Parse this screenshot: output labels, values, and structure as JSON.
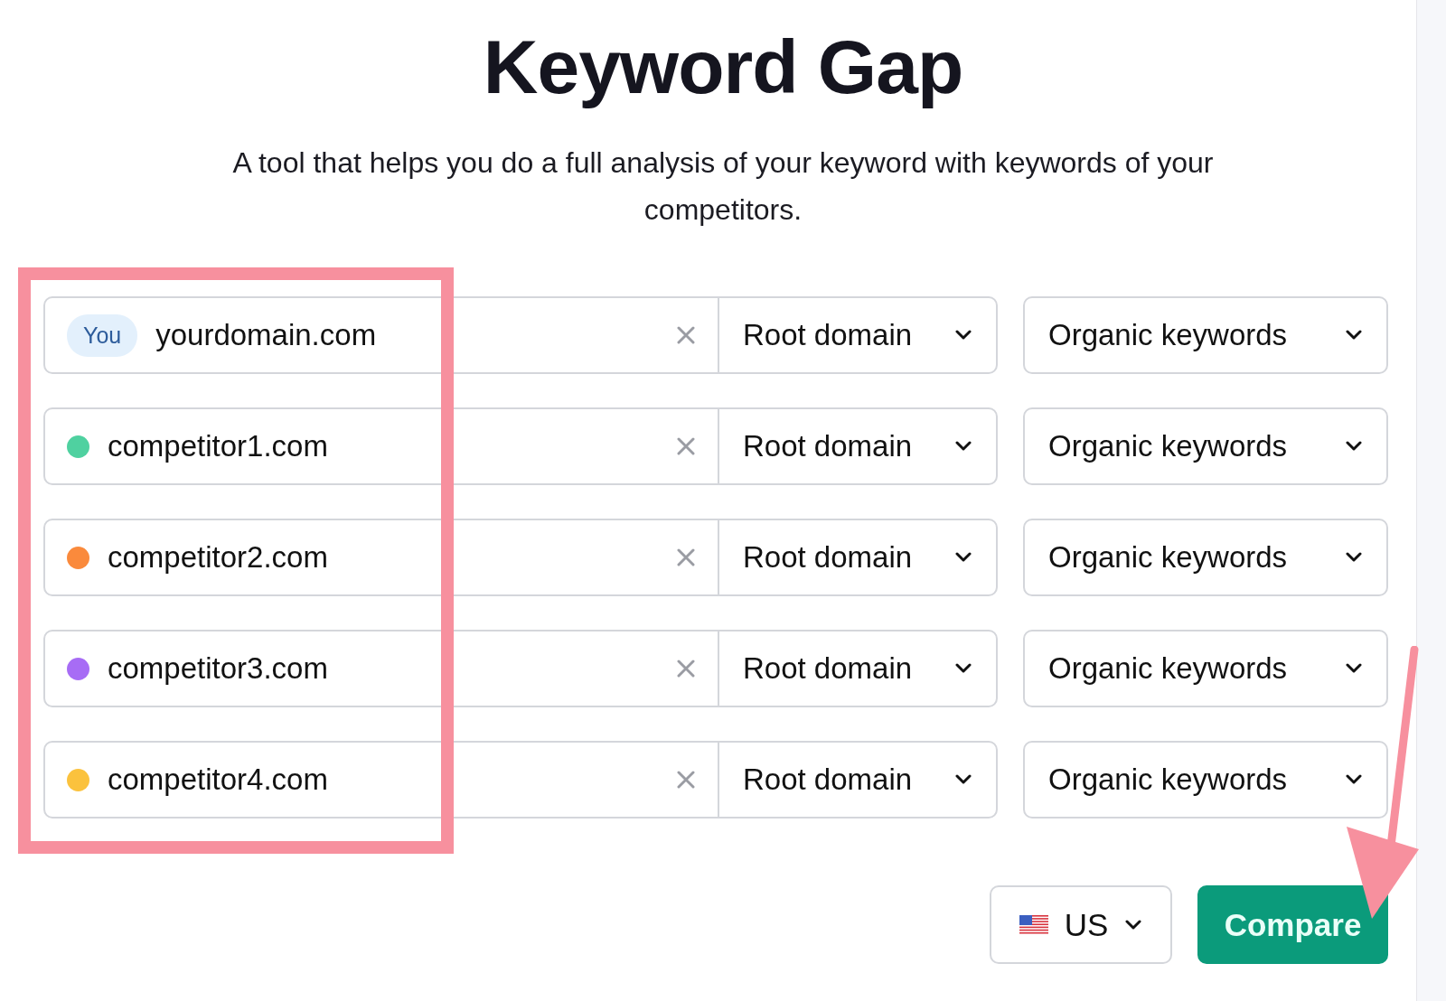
{
  "title": "Keyword Gap",
  "subtitle": "A tool that helps you do a full analysis of your keyword with keywords of your competitors.",
  "rows": [
    {
      "kind": "you",
      "badge": "You",
      "domain": "yourdomain.com",
      "scope": "Root domain",
      "keyword_type": "Organic keywords"
    },
    {
      "kind": "competitor",
      "color": "#4fd1a0",
      "domain": "competitor1.com",
      "scope": "Root domain",
      "keyword_type": "Organic keywords"
    },
    {
      "kind": "competitor",
      "color": "#fa8a3c",
      "domain": "competitor2.com",
      "scope": "Root domain",
      "keyword_type": "Organic keywords"
    },
    {
      "kind": "competitor",
      "color": "#a76cf5",
      "domain": "competitor3.com",
      "scope": "Root domain",
      "keyword_type": "Organic keywords"
    },
    {
      "kind": "competitor",
      "color": "#fbc23d",
      "domain": "competitor4.com",
      "scope": "Root domain",
      "keyword_type": "Organic keywords"
    }
  ],
  "country": "US",
  "button": "Compare"
}
